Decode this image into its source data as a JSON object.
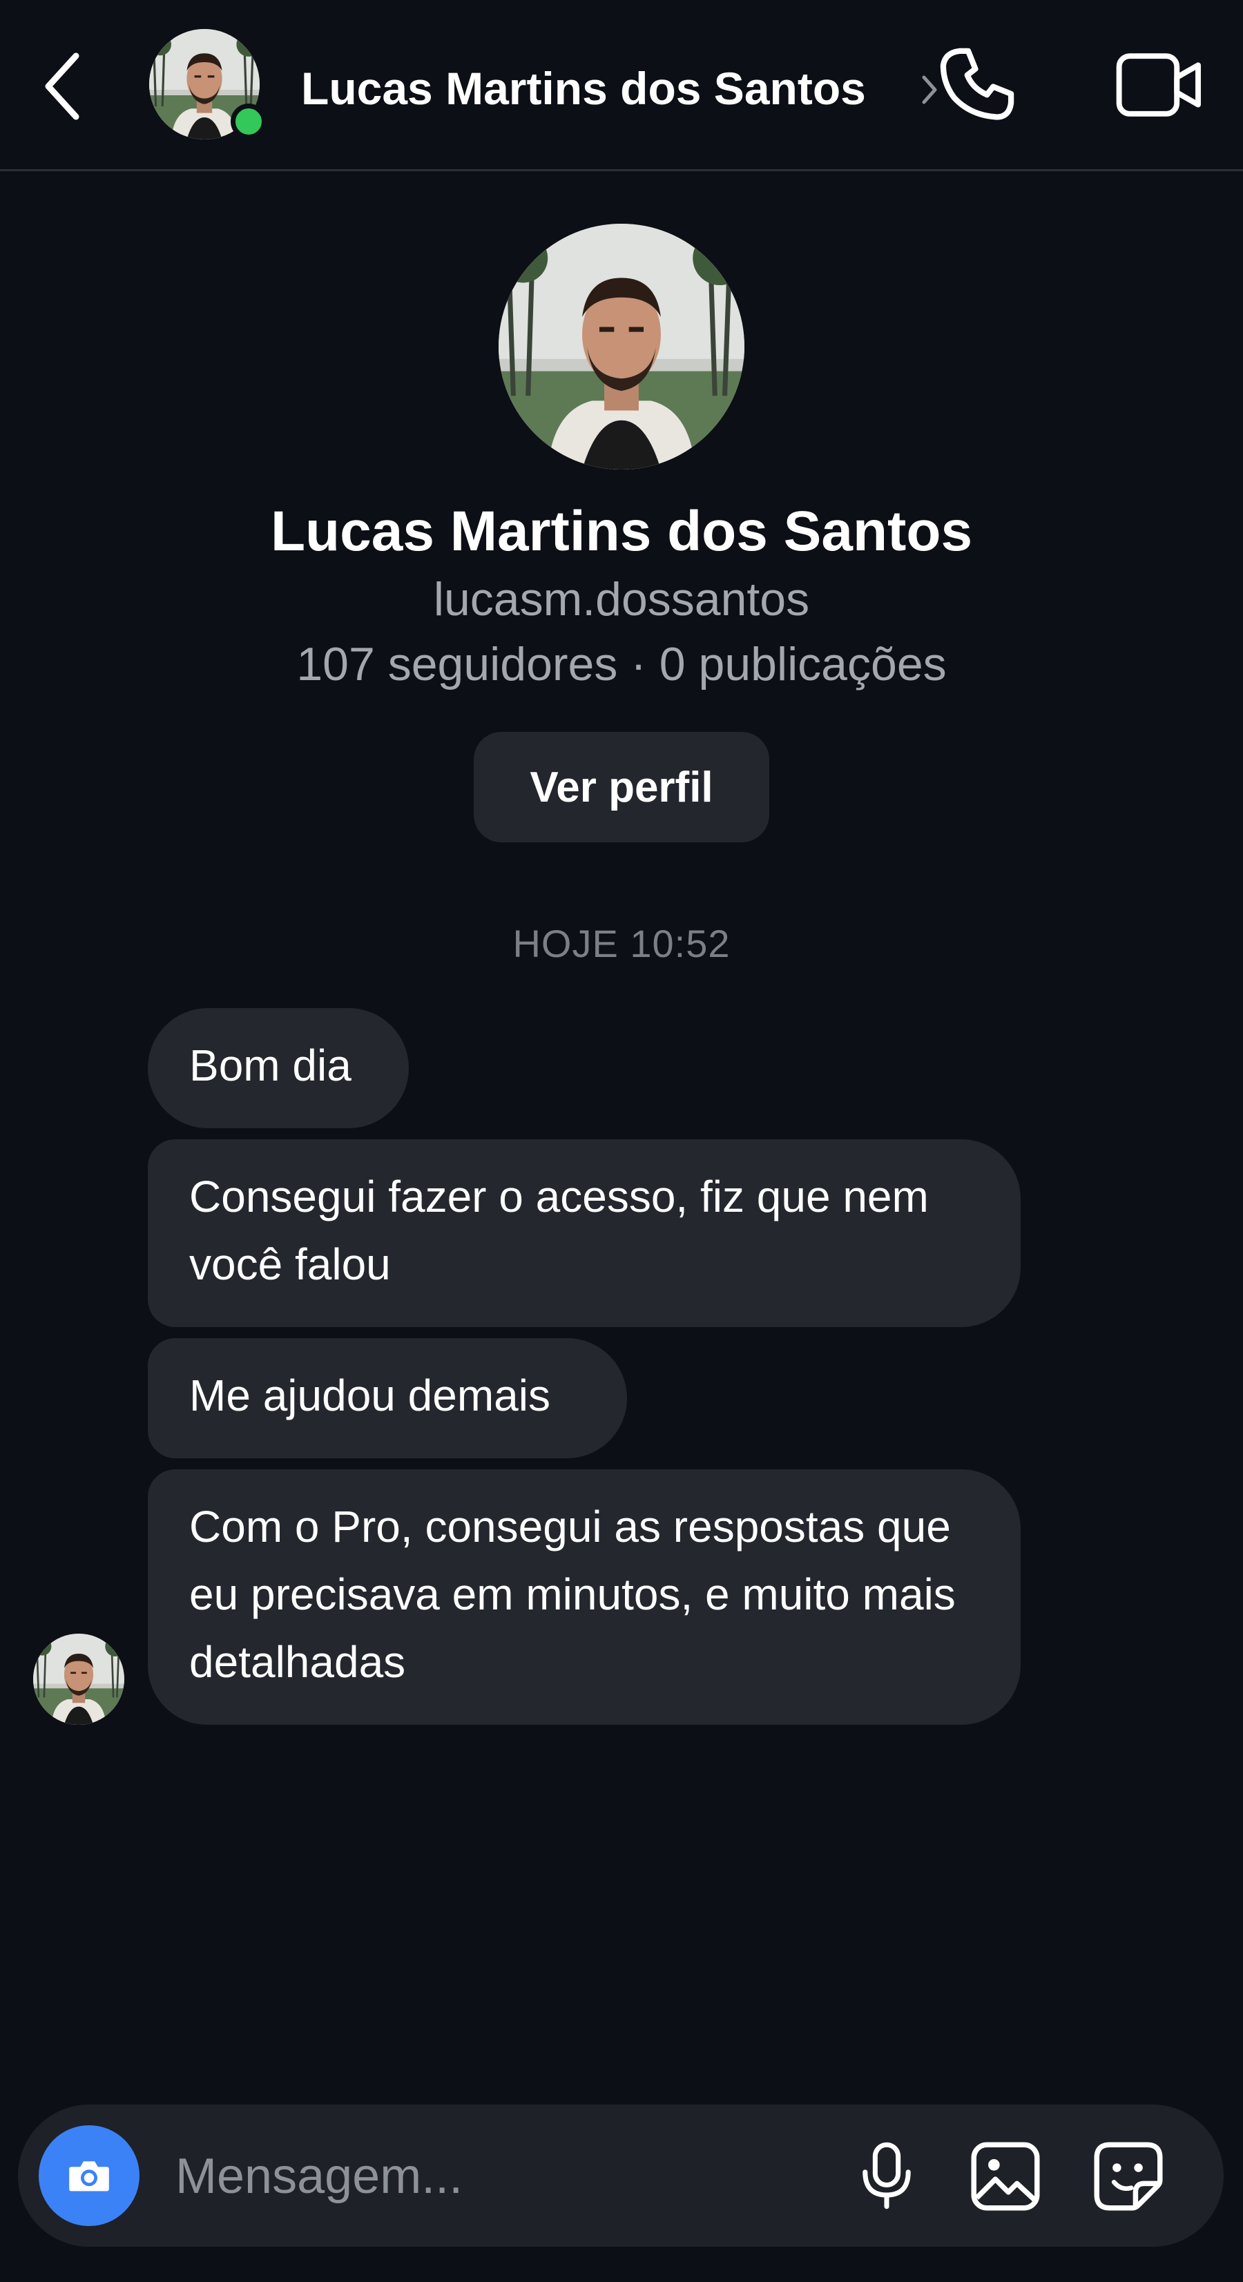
{
  "header": {
    "name": "Lucas Martins dos Santos",
    "back_icon": "chevron-left-icon",
    "call_icon": "phone-icon",
    "video_icon": "video-camera-icon",
    "online_color": "#34c759"
  },
  "profile": {
    "name": "Lucas Martins dos Santos",
    "username": "lucasm.dossantos",
    "stats": "107 seguidores · 0 publicações",
    "view_profile_label": "Ver perfil"
  },
  "conversation": {
    "timestamp": "HOJE 10:52",
    "messages": [
      {
        "text": "Bom dia"
      },
      {
        "text": "Consegui fazer o acesso, fiz que nem você falou"
      },
      {
        "text": "Me ajudou demais"
      },
      {
        "text": "Com o Pro, consegui as respostas que eu precisava em minutos, e muito mais detalhadas"
      }
    ]
  },
  "composer": {
    "placeholder": "Mensagem...",
    "camera_icon": "camera-icon",
    "mic_icon": "microphone-icon",
    "gallery_icon": "image-icon",
    "sticker_icon": "sticker-icon",
    "accent_color": "#3b82f6"
  }
}
